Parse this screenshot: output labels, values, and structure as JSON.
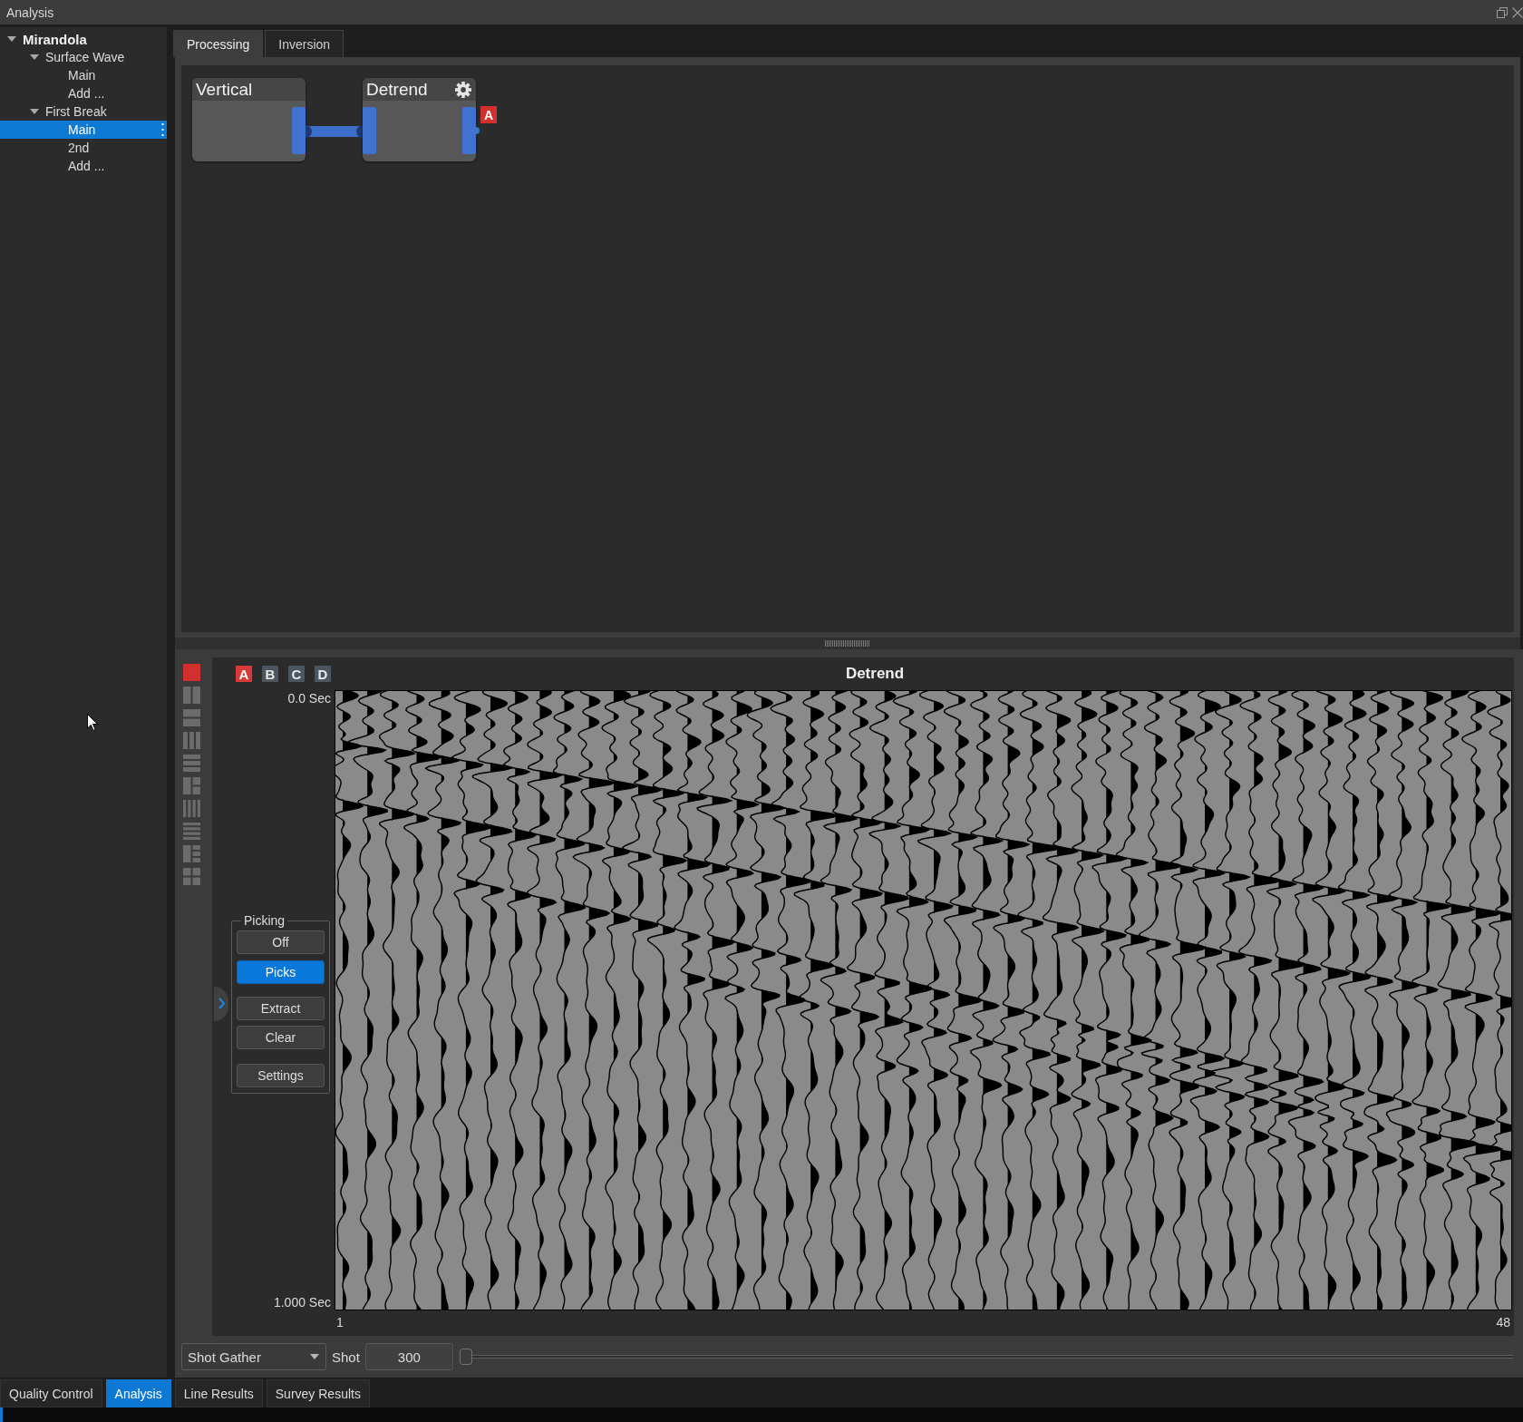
{
  "window": {
    "title": "Analysis"
  },
  "tree": [
    {
      "label": "Mirandola",
      "expanded": true,
      "selected": false,
      "children": [
        {
          "label": "Surface Wave",
          "expanded": true,
          "selected": false,
          "children": [
            {
              "label": "Main",
              "selected": false
            },
            {
              "label": "Add ...",
              "selected": false
            }
          ]
        },
        {
          "label": "First Break",
          "expanded": true,
          "selected": false,
          "children": [
            {
              "label": "Main",
              "selected": true
            },
            {
              "label": "2nd",
              "selected": false
            },
            {
              "label": "Add ...",
              "selected": false
            }
          ]
        }
      ]
    }
  ],
  "tabs": [
    {
      "label": "Processing",
      "selected": true
    },
    {
      "label": "Inversion",
      "selected": false
    }
  ],
  "flow": {
    "nodes": [
      {
        "title": "Vertical",
        "settings": false,
        "input_port": false,
        "output_port": true
      },
      {
        "title": "Detrend",
        "settings": true,
        "input_port": true,
        "output_port": true,
        "badge": "A"
      }
    ]
  },
  "viewer": {
    "layouts": [
      {
        "kind": "single",
        "selected": true
      },
      {
        "kind": "cols2",
        "selected": false
      },
      {
        "kind": "rows2",
        "selected": false
      },
      {
        "kind": "cols3",
        "selected": false
      },
      {
        "kind": "rows3",
        "selected": false
      },
      {
        "kind": "split3",
        "selected": false
      },
      {
        "kind": "cols4",
        "selected": false
      },
      {
        "kind": "rows4",
        "selected": false
      },
      {
        "kind": "split4",
        "selected": false
      },
      {
        "kind": "grid4",
        "selected": false
      }
    ],
    "slots": [
      {
        "label": "A",
        "selected": true
      },
      {
        "label": "B",
        "selected": false
      },
      {
        "label": "C",
        "selected": false
      },
      {
        "label": "D",
        "selected": false
      }
    ],
    "title": "Detrend",
    "time_top": "0.0 Sec",
    "time_bottom": "1.000 Sec",
    "trace_first": "1",
    "trace_last": "48",
    "picking": {
      "title": "Picking",
      "modes": [
        {
          "label": "Off",
          "selected": false
        },
        {
          "label": "Picks",
          "selected": true
        }
      ],
      "action_groups": [
        [
          "Extract",
          "Clear"
        ],
        [
          "Settings"
        ]
      ]
    }
  },
  "controls": {
    "gather": {
      "value": "Shot Gather"
    },
    "shot_label": "Shot",
    "shot": {
      "value": "300"
    },
    "slider": {
      "level": 0
    }
  },
  "bottom_tabs": [
    {
      "label": "Quality Control",
      "selected": false
    },
    {
      "label": "Analysis",
      "selected": true
    },
    {
      "label": "Line Results",
      "selected": false
    },
    {
      "label": "Survey Results",
      "selected": false
    }
  ]
}
